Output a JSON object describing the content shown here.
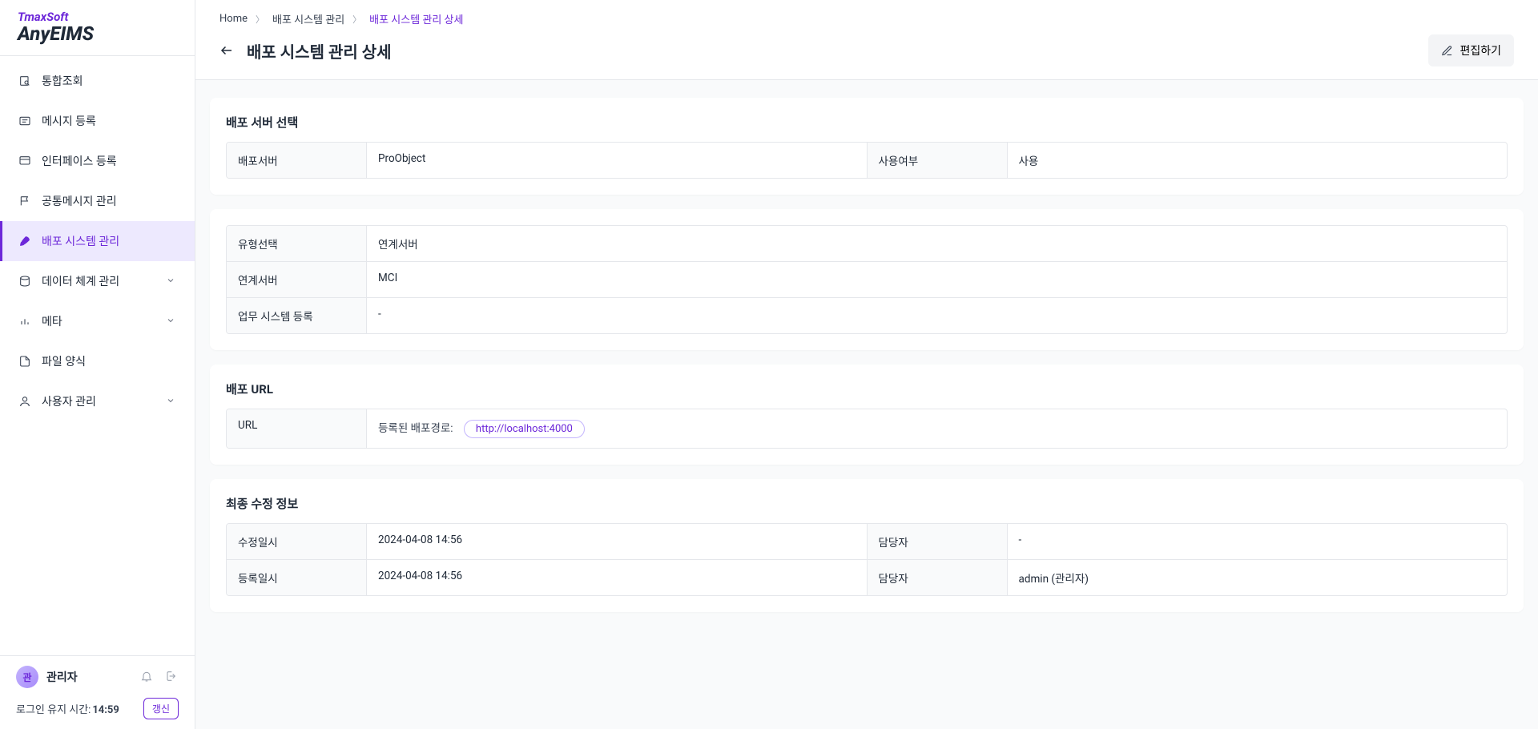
{
  "brand": {
    "company": "TmaxSoft",
    "product": "AnyEIMS"
  },
  "sidebar": {
    "items": [
      {
        "label": "통합조회"
      },
      {
        "label": "메시지 등록"
      },
      {
        "label": "인터페이스 등록"
      },
      {
        "label": "공통메시지 관리"
      },
      {
        "label": "배포 시스템 관리"
      },
      {
        "label": "데이터 체계 관리"
      },
      {
        "label": "메타"
      },
      {
        "label": "파일 양식"
      },
      {
        "label": "사용자 관리"
      }
    ]
  },
  "user": {
    "avatar_initial": "관",
    "name": "관리자"
  },
  "session": {
    "label": "로그인 유지 시간:",
    "time": "14:59",
    "refresh": "갱신"
  },
  "breadcrumb": {
    "home": "Home",
    "level1": "배포 시스템 관리",
    "level2": "배포 시스템 관리 상세"
  },
  "page": {
    "title": "배포 시스템 관리 상세",
    "edit": "편집하기"
  },
  "section_server": {
    "title": "배포 서버 선택",
    "row1_label1": "배포서버",
    "row1_value1": "ProObject",
    "row1_label2": "사용여부",
    "row1_value2": "사용"
  },
  "section_type": {
    "row1_label": "유형선택",
    "row1_value": "연계서버",
    "row2_label": "연계서버",
    "row2_value": "MCI",
    "row3_label": "업무 시스템 등록",
    "row3_value": "-"
  },
  "section_url": {
    "title": "배포 URL",
    "label": "URL",
    "prefix": "등록된 배포경로:",
    "url": "http://localhost:4000"
  },
  "section_mod": {
    "title": "최종 수정 정보",
    "row1_label1": "수정일시",
    "row1_value1": "2024-04-08 14:56",
    "row1_label2": "담당자",
    "row1_value2": "-",
    "row2_label1": "등록일시",
    "row2_value1": "2024-04-08 14:56",
    "row2_label2": "담당자",
    "row2_value2": "admin (관리자)"
  }
}
